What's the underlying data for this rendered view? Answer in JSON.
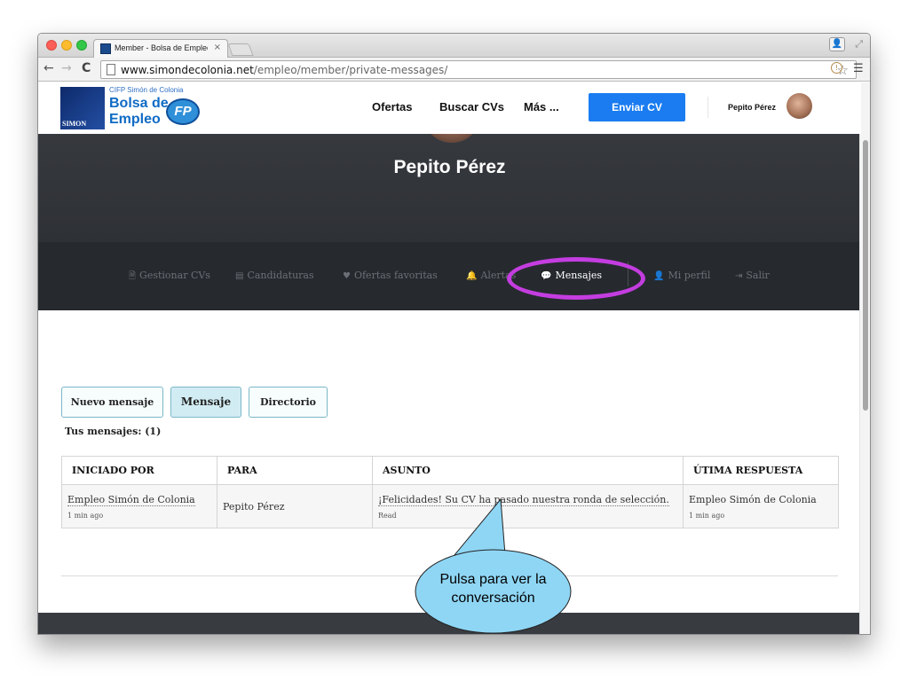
{
  "browser": {
    "tab_title": "Member - Bolsa de Emplec",
    "tab_close": "×",
    "url_domain": "www.simondecolonia.net",
    "url_path": "/empleo/member/private-messages/"
  },
  "site": {
    "logo_small": "CIFP Simón de Colonia",
    "logo_line1": "Bolsa de",
    "logo_line2": "Empleo",
    "logo_mark": "SIMON",
    "logo_fp": "FP",
    "nav": [
      "Ofertas",
      "Buscar CVs",
      "Más ..."
    ],
    "cta": "Enviar CV",
    "user_name": "Pepito Pérez"
  },
  "hero": {
    "name": "Pepito Pérez"
  },
  "account_nav": {
    "items": [
      {
        "icon": "🗎",
        "label": "Gestionar CVs"
      },
      {
        "icon": "▤",
        "label": "Candidaturas"
      },
      {
        "icon": "♥",
        "label": "Ofertas favoritas"
      },
      {
        "icon": "🔔",
        "label": "Alertas"
      },
      {
        "icon": "💬",
        "label": "Mensajes"
      },
      {
        "icon": "👤",
        "label": "Mi perfil"
      },
      {
        "icon": "⇥",
        "label": "Salir"
      }
    ],
    "highlight_color": "#c43de0"
  },
  "messages": {
    "buttons": [
      "Nuevo mensaje",
      "Mensaje",
      "Directorio"
    ],
    "count_label": "Tus mensajes: (1)",
    "headers": [
      "INICIADO POR",
      "PARA",
      "ASUNTO",
      "ÚTIMA RESPUESTA"
    ],
    "rows": [
      {
        "from": "Empleo Simón de Colonia",
        "from_time": "1 min ago",
        "to": "Pepito Pérez",
        "subject": "¡Felicidades! Su CV ha pasado nuestra ronda de selección.",
        "status": "Read",
        "last_reply": "Empleo Simón de Colonia",
        "last_time": "1 min ago"
      }
    ]
  },
  "callout": {
    "line1": "Pulsa para ver la",
    "line2": "conversación",
    "color": "#8fd6f5"
  }
}
